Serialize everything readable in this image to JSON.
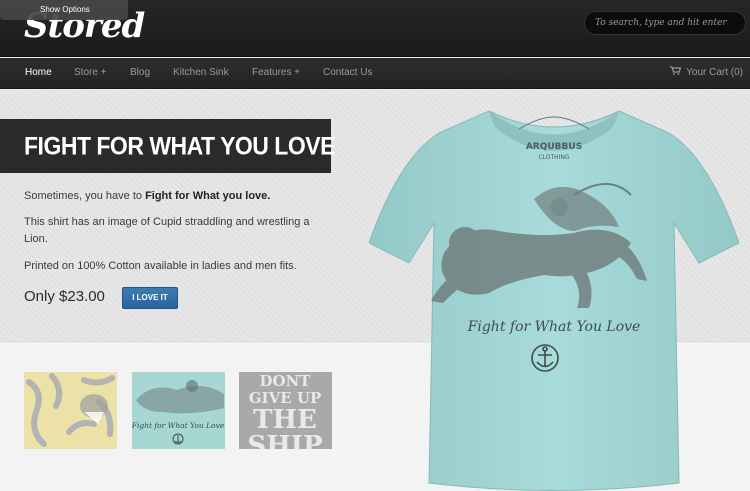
{
  "header": {
    "logo": "Stored",
    "show_options": "Show Options",
    "search_placeholder": "To search, type and hit enter"
  },
  "nav": {
    "items": [
      {
        "label": "Home",
        "active": true
      },
      {
        "label": "Store +"
      },
      {
        "label": "Blog"
      },
      {
        "label": "Kitchen Sink"
      },
      {
        "label": "Features +"
      },
      {
        "label": "Contact Us"
      }
    ],
    "cart": "Your Cart (0)"
  },
  "product": {
    "title": "FIGHT FOR WHAT YOU LOVE",
    "intro_prefix": "Sometimes, you have to ",
    "intro_bold": "Fight for What you love.",
    "description": "This shirt has an image of Cupid straddling and wrestling a Lion.",
    "material": "Printed on 100% Cotton available in ladies and men fits.",
    "price": "Only $23.00",
    "button": "I LOVE IT"
  },
  "shirt_print": {
    "brand_line1": "ARQUBBUS",
    "brand_line2": "CLOTHING",
    "slogan": "Fight for What You Love"
  },
  "thumbnails": {
    "thumb2_text": "Fight for What You Love",
    "thumb3_lines": [
      "DONT",
      "GIVE UP",
      "THE",
      "SHIP"
    ]
  },
  "colors": {
    "shirt": "#a3d6d5",
    "button": "#2e6aa5",
    "title_bar": "#2a2a2a"
  }
}
